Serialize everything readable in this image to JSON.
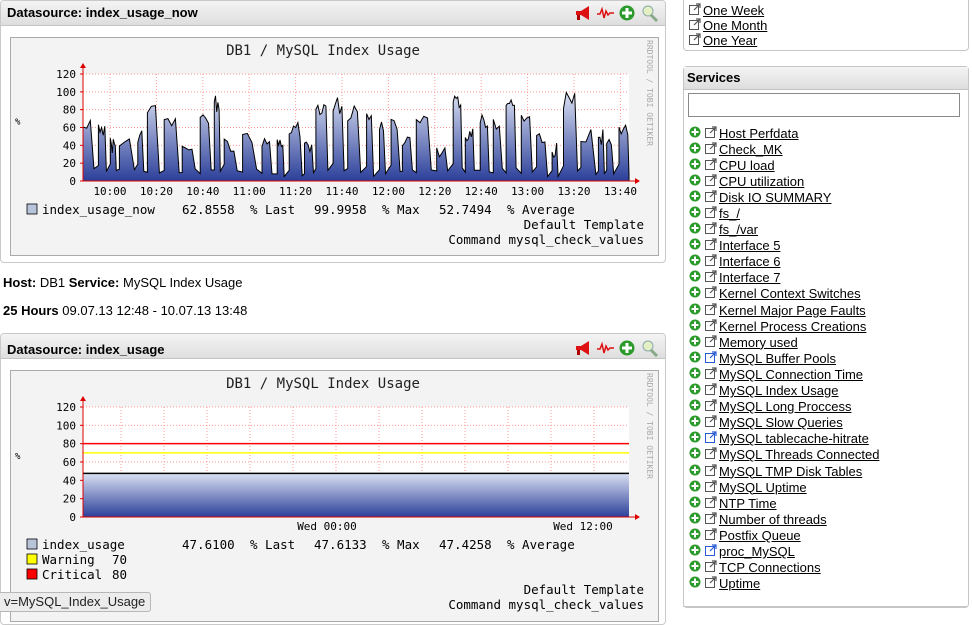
{
  "panel1": {
    "title": "Datasource: index_usage_now",
    "graph": {
      "title": "DB1 / MySQL Index Usage",
      "side_label": "RRDTOOL / TOBI OETIKER",
      "y_ticks": [
        "120",
        "100",
        "80",
        "60",
        "40",
        "20",
        "0"
      ],
      "x_ticks": [
        "10:00",
        "10:20",
        "10:40",
        "11:00",
        "11:20",
        "11:40",
        "12:00",
        "12:20",
        "12:40",
        "13:00",
        "13:20",
        "13:40"
      ],
      "legend": {
        "name": "index_usage_now",
        "last": "62.8558",
        "last_label": "% Last",
        "max": "99.9958",
        "max_label": "% Max",
        "avg": "52.7494",
        "avg_label": "% Average",
        "color": "#4a5ea8"
      },
      "footer1": "Default Template",
      "footer2": "Command mysql_check_values"
    }
  },
  "host_line": {
    "host_label": "Host:",
    "host": "DB1",
    "service_label": "Service:",
    "service": "MySQL Index Usage"
  },
  "range_line": {
    "label": "25 Hours",
    "range": "09.07.13 12:48 - 10.07.13 13:48"
  },
  "panel2": {
    "title": "Datasource: index_usage",
    "graph": {
      "title": "DB1 / MySQL Index Usage",
      "side_label": "RRDTOOL / TOBI OETIKER",
      "y_ticks": [
        "120",
        "100",
        "80",
        "60",
        "40",
        "20",
        "0"
      ],
      "x_ticks": [
        "Wed 00:00",
        "Wed 12:00"
      ],
      "legend": {
        "name": "index_usage",
        "last": "47.6100",
        "last_label": "% Last",
        "max": "47.6133",
        "max_label": "% Max",
        "avg": "47.4258",
        "avg_label": "% Average",
        "color": "#4a5ea8"
      },
      "warning": {
        "label": "Warning",
        "value": "70",
        "color": "#ffff00"
      },
      "critical": {
        "label": "Critical",
        "value": "80",
        "color": "#ff0000"
      },
      "footer1": "Default Template",
      "footer2": "Command mysql_check_values"
    }
  },
  "url_tip": "v=MySQL_Index_Usage",
  "time_links": [
    "One Week",
    "One Month",
    "One Year"
  ],
  "services": {
    "title": "Services",
    "search_value": "",
    "items": [
      {
        "label": "Host Perfdata",
        "icon": "external-link-icon"
      },
      {
        "label": "Check_MK",
        "icon": "external-link-icon"
      },
      {
        "label": "CPU load",
        "icon": "external-link-icon"
      },
      {
        "label": "CPU utilization",
        "icon": "external-link-icon"
      },
      {
        "label": "Disk IO SUMMARY",
        "icon": "external-link-icon"
      },
      {
        "label": "fs_/",
        "icon": "external-link-icon"
      },
      {
        "label": "fs_/var",
        "icon": "external-link-icon"
      },
      {
        "label": "Interface 5",
        "icon": "external-link-icon"
      },
      {
        "label": "Interface 6",
        "icon": "external-link-icon"
      },
      {
        "label": "Interface 7",
        "icon": "external-link-icon"
      },
      {
        "label": "Kernel Context Switches",
        "icon": "external-link-icon"
      },
      {
        "label": "Kernel Major Page Faults",
        "icon": "external-link-icon"
      },
      {
        "label": "Kernel Process Creations",
        "icon": "external-link-icon"
      },
      {
        "label": "Memory used",
        "icon": "external-link-icon"
      },
      {
        "label": "MySQL Buffer Pools",
        "icon": "external-link-blue-icon"
      },
      {
        "label": "MySQL Connection Time",
        "icon": "external-link-icon"
      },
      {
        "label": "MySQL Index Usage",
        "icon": "external-link-icon"
      },
      {
        "label": "MySQL Long Proccess",
        "icon": "external-link-icon"
      },
      {
        "label": "MySQL Slow Queries",
        "icon": "external-link-icon"
      },
      {
        "label": "MySQL tablecache-hitrate",
        "icon": "external-link-blue-icon"
      },
      {
        "label": "MySQL Threads Connected",
        "icon": "external-link-icon"
      },
      {
        "label": "MySQL TMP Disk Tables",
        "icon": "external-link-icon"
      },
      {
        "label": "MySQL Uptime",
        "icon": "external-link-icon"
      },
      {
        "label": "NTP Time",
        "icon": "external-link-icon"
      },
      {
        "label": "Number of threads",
        "icon": "external-link-icon"
      },
      {
        "label": "Postfix Queue",
        "icon": "external-link-icon"
      },
      {
        "label": "proc_MySQL",
        "icon": "external-link-blue-icon"
      },
      {
        "label": "TCP Connections",
        "icon": "external-link-icon"
      },
      {
        "label": "Uptime",
        "icon": "external-link-icon"
      }
    ]
  }
}
